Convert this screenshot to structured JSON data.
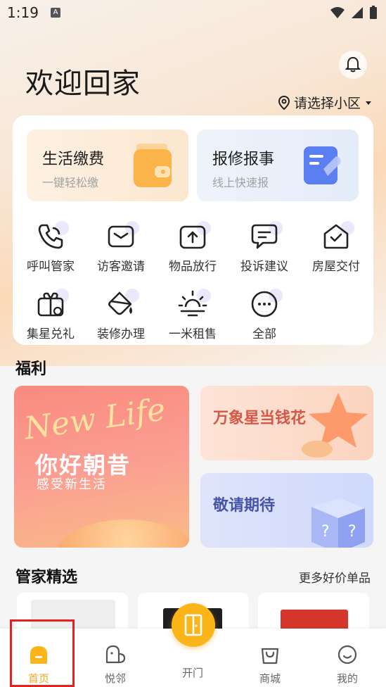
{
  "status": {
    "time": "1:19",
    "badge": "A"
  },
  "header": {
    "title": "欢迎回家",
    "community": "请选择小区"
  },
  "tiles": [
    {
      "title": "生活缴费",
      "sub": "一键轻松缴"
    },
    {
      "title": "报修报事",
      "sub": "线上快速报"
    }
  ],
  "services": [
    {
      "label": "呼叫管家",
      "icon": "phone-icon"
    },
    {
      "label": "访客邀请",
      "icon": "mail-icon"
    },
    {
      "label": "物品放行",
      "icon": "upload-box-icon"
    },
    {
      "label": "投诉建议",
      "icon": "message-icon"
    },
    {
      "label": "房屋交付",
      "icon": "house-check-icon"
    },
    {
      "label": "集星兑礼",
      "icon": "gift-icon"
    },
    {
      "label": "装修办理",
      "icon": "paint-bucket-icon"
    },
    {
      "label": "一米租售",
      "icon": "sun-icon"
    },
    {
      "label": "全部",
      "icon": "more-icon"
    }
  ],
  "welfare": {
    "title": "福利",
    "big": {
      "deco": "New Life",
      "title": "你好朝昔",
      "sub": "感受新生活"
    },
    "small1": "万象星当钱花",
    "small2": "敬请期待"
  },
  "picks": {
    "title": "管家精选",
    "more": "更多好价单品"
  },
  "tabbar": [
    {
      "label": "首页",
      "icon": "home-icon"
    },
    {
      "label": "悦邻",
      "icon": "neighbor-icon"
    },
    {
      "label": "开门",
      "icon": "door-icon"
    },
    {
      "label": "商城",
      "icon": "shopping-bag-icon"
    },
    {
      "label": "我的",
      "icon": "smile-icon"
    }
  ],
  "colors": {
    "accent": "#fbb519",
    "active": "#f5a623",
    "highlight": "#e52222"
  }
}
